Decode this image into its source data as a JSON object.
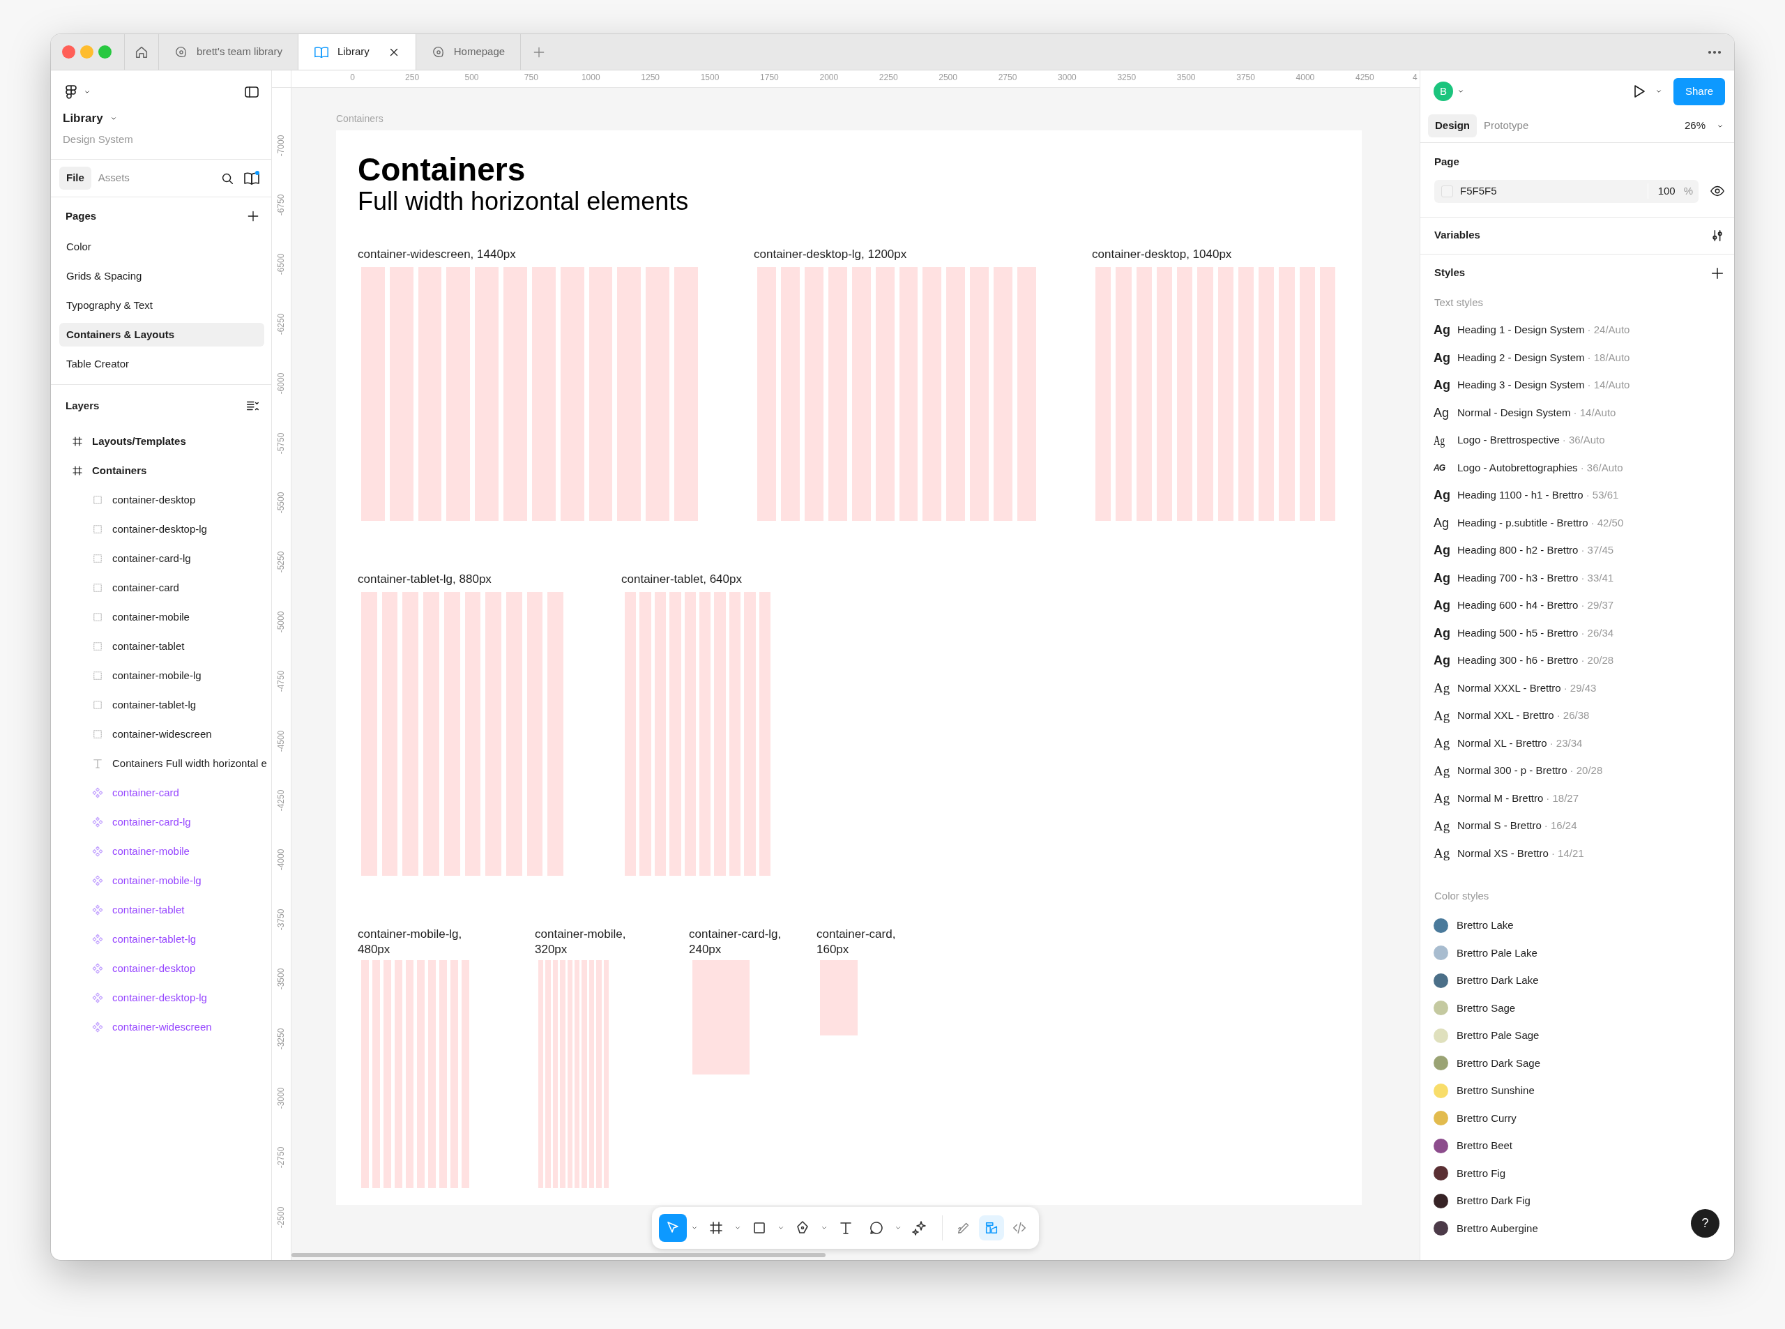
{
  "window": {
    "tabs": [
      {
        "kind": "home",
        "selected": false
      },
      {
        "kind": "file",
        "label": "brett's team library",
        "selected": false
      },
      {
        "kind": "library",
        "label": "Library",
        "selected": true,
        "closable": true
      },
      {
        "kind": "file",
        "label": "Homepage",
        "selected": false
      }
    ]
  },
  "left_panel": {
    "file_name": "Library",
    "project": "Design System",
    "tabs": [
      {
        "label": "File",
        "selected": true
      },
      {
        "label": "Assets",
        "selected": false
      }
    ],
    "pages_title": "Pages",
    "pages": [
      {
        "label": "Color",
        "selected": false
      },
      {
        "label": "Grids & Spacing",
        "selected": false
      },
      {
        "label": "Typography & Text",
        "selected": false
      },
      {
        "label": "Containers & Layouts",
        "selected": true
      },
      {
        "label": "Table Creator",
        "selected": false
      }
    ],
    "layers_title": "Layers",
    "layers": [
      {
        "kind": "frame",
        "label": "Layouts/Templates"
      },
      {
        "kind": "frame",
        "label": "Containers",
        "children": [
          {
            "kind": "rect",
            "label": "container-desktop"
          },
          {
            "kind": "rect",
            "label": "container-desktop-lg"
          },
          {
            "kind": "rect",
            "label": "container-card-lg"
          },
          {
            "kind": "rect",
            "label": "container-card"
          },
          {
            "kind": "rect",
            "label": "container-mobile"
          },
          {
            "kind": "rect",
            "label": "container-tablet"
          },
          {
            "kind": "rect",
            "label": "container-mobile-lg"
          },
          {
            "kind": "rect",
            "label": "container-tablet-lg"
          },
          {
            "kind": "rect",
            "label": "container-widescreen"
          },
          {
            "kind": "text",
            "label": "Containers Full width horizontal e"
          },
          {
            "kind": "component",
            "label": "container-card"
          },
          {
            "kind": "component",
            "label": "container-card-lg"
          },
          {
            "kind": "component",
            "label": "container-mobile"
          },
          {
            "kind": "component",
            "label": "container-mobile-lg"
          },
          {
            "kind": "component",
            "label": "container-tablet"
          },
          {
            "kind": "component",
            "label": "container-tablet-lg"
          },
          {
            "kind": "component",
            "label": "container-desktop"
          },
          {
            "kind": "component",
            "label": "container-desktop-lg"
          },
          {
            "kind": "component",
            "label": "container-widescreen"
          }
        ]
      }
    ]
  },
  "ruler": {
    "x_labels": [
      "0",
      "250",
      "500",
      "750",
      "1000",
      "1250",
      "1500",
      "1750",
      "2000",
      "2250",
      "2500",
      "2750",
      "3000",
      "3250",
      "3500",
      "3750",
      "4000",
      "4250",
      "4"
    ],
    "y_labels": [
      "-7000",
      "-6750",
      "-6500",
      "-6250",
      "-6000",
      "-5750",
      "-5500",
      "-5250",
      "-5000",
      "-4750",
      "-4500",
      "-4250",
      "-4000",
      "-3750",
      "-3500",
      "-3250",
      "-3000",
      "-2750",
      "-2500"
    ]
  },
  "canvas": {
    "frame_label": "Containers",
    "title": "Containers",
    "subtitle": "Full width horizontal elements",
    "containers": [
      {
        "label": "container-widescreen, 1440px",
        "kind": "grid12"
      },
      {
        "label": "container-desktop-lg, 1200px",
        "kind": "grid12"
      },
      {
        "label": "container-desktop, 1040px",
        "kind": "grid12"
      },
      {
        "label": "container-tablet-lg, 880px",
        "kind": "grid10"
      },
      {
        "label": "container-tablet, 640px",
        "kind": "grid10"
      },
      {
        "label": "container-mobile-lg, 480px",
        "kind": "grid10"
      },
      {
        "label": "container-mobile, 320px",
        "kind": "grid10"
      },
      {
        "label": "container-card-lg, 240px",
        "kind": "block"
      },
      {
        "label": "container-card, 160px",
        "kind": "block"
      }
    ]
  },
  "toolbar": {
    "tools": [
      {
        "kind": "move",
        "selected": true,
        "menu": true
      },
      {
        "kind": "frame",
        "selected": false,
        "menu": true
      },
      {
        "kind": "rectangle",
        "selected": false,
        "menu": true
      },
      {
        "kind": "pen",
        "selected": false,
        "menu": true
      },
      {
        "kind": "text",
        "selected": false,
        "menu": false
      },
      {
        "kind": "comment",
        "selected": false,
        "menu": true
      },
      {
        "kind": "actions",
        "selected": false,
        "menu": false
      }
    ],
    "modes": [
      {
        "kind": "draw",
        "selected": false
      },
      {
        "kind": "design",
        "selected": true
      },
      {
        "kind": "dev",
        "selected": false
      }
    ]
  },
  "right_panel": {
    "avatar": "B",
    "share": "Share",
    "tabs": [
      {
        "label": "Design",
        "selected": true
      },
      {
        "label": "Prototype",
        "selected": false
      }
    ],
    "zoom": "26%",
    "page_title": "Page",
    "page_color": "F5F5F5",
    "page_opacity": "100",
    "opacity_unit": "%",
    "variables_title": "Variables",
    "styles_title": "Styles",
    "text_styles_title": "Text styles",
    "text_styles": [
      {
        "sample": "Ag",
        "kind": "bold",
        "name": "Heading 1 - Design System",
        "detail": "· 24/Auto"
      },
      {
        "sample": "Ag",
        "kind": "bold",
        "name": "Heading 2 - Design System",
        "detail": "· 18/Auto"
      },
      {
        "sample": "Ag",
        "kind": "bold",
        "name": "Heading 3 - Design System",
        "detail": "· 14/Auto"
      },
      {
        "sample": "Ag",
        "kind": "regular",
        "name": "Normal - Design System",
        "detail": "· 14/Auto"
      },
      {
        "sample": "Ag",
        "kind": "condensed",
        "name": "Logo - Brettrospective",
        "detail": "· 36/Auto"
      },
      {
        "sample": "AG",
        "kind": "caps",
        "name": "Logo - Autobrettographies",
        "detail": "· 36/Auto"
      },
      {
        "sample": "Ag",
        "kind": "bold",
        "name": "Heading 1100 - h1 - Brettro",
        "detail": "· 53/61"
      },
      {
        "sample": "Ag",
        "kind": "regular",
        "name": "Heading - p.subtitle - Brettro",
        "detail": "· 42/50"
      },
      {
        "sample": "Ag",
        "kind": "bold",
        "name": "Heading 800 - h2 - Brettro",
        "detail": "· 37/45"
      },
      {
        "sample": "Ag",
        "kind": "bold",
        "name": "Heading 700 - h3 - Brettro",
        "detail": "· 33/41"
      },
      {
        "sample": "Ag",
        "kind": "bold",
        "name": "Heading 600 - h4 - Brettro",
        "detail": "· 29/37"
      },
      {
        "sample": "Ag",
        "kind": "bold",
        "name": "Heading 500 - h5 - Brettro",
        "detail": "· 26/34"
      },
      {
        "sample": "Ag",
        "kind": "bold",
        "name": "Heading 300 - h6 - Brettro",
        "detail": "· 20/28"
      },
      {
        "sample": "Ag",
        "kind": "serif",
        "name": "Normal XXXL - Brettro",
        "detail": "· 29/43"
      },
      {
        "sample": "Ag",
        "kind": "serif",
        "name": "Normal XXL - Brettro",
        "detail": "· 26/38"
      },
      {
        "sample": "Ag",
        "kind": "serif",
        "name": "Normal XL - Brettro",
        "detail": "· 23/34"
      },
      {
        "sample": "Ag",
        "kind": "serif",
        "name": "Normal 300 - p - Brettro",
        "detail": "· 20/28"
      },
      {
        "sample": "Ag",
        "kind": "serif",
        "name": "Normal M - Brettro",
        "detail": "· 18/27"
      },
      {
        "sample": "Ag",
        "kind": "serif",
        "name": "Normal S - Brettro",
        "detail": "· 16/24"
      },
      {
        "sample": "Ag",
        "kind": "serif",
        "name": "Normal XS - Brettro",
        "detail": "· 14/21"
      }
    ],
    "color_styles_title": "Color styles",
    "color_styles": [
      {
        "name": "Brettro Lake",
        "color": "#4a7a9b"
      },
      {
        "name": "Brettro Pale Lake",
        "color": "#a8bccf"
      },
      {
        "name": "Brettro Dark Lake",
        "color": "#4b6f88"
      },
      {
        "name": "Brettro Sage",
        "color": "#c4c9a0"
      },
      {
        "name": "Brettro Pale Sage",
        "color": "#dfe0bd"
      },
      {
        "name": "Brettro Dark Sage",
        "color": "#9aa374"
      },
      {
        "name": "Brettro Sunshine",
        "color": "#f8dd6a"
      },
      {
        "name": "Brettro Curry",
        "color": "#e2bb4e"
      },
      {
        "name": "Brettro Beet",
        "color": "#8c4c8c"
      },
      {
        "name": "Brettro Fig",
        "color": "#5a2f33"
      },
      {
        "name": "Brettro Dark Fig",
        "color": "#372326"
      },
      {
        "name": "Brettro Aubergine",
        "color": "#4c3a48"
      }
    ]
  },
  "help": "?"
}
